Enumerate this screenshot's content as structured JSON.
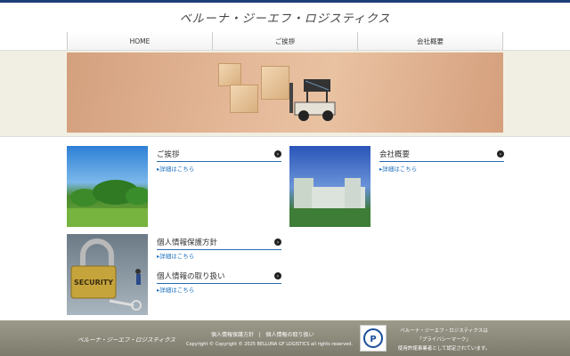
{
  "header": {
    "title": "ベルーナ・ジーエフ・ロジスティクス"
  },
  "nav": {
    "items": [
      {
        "label": "HOME"
      },
      {
        "label": "ご挨拶"
      },
      {
        "label": "会社概要"
      }
    ]
  },
  "sections": {
    "greeting": {
      "title": "ご挨拶",
      "link": "詳細はこちら"
    },
    "company": {
      "title": "会社概要",
      "link": "詳細はこちら"
    },
    "privacy_policy": {
      "title": "個人情報保護方針",
      "link": "詳細はこちら"
    },
    "privacy_handling": {
      "title": "個人情報の取り扱い",
      "link": "詳細はこちら"
    }
  },
  "thumb_text": {
    "security": "SECURITY"
  },
  "footer": {
    "company": "ベルーナ・ジーエフ・ロジスティクス",
    "link1": "個人情報保護方針",
    "separator": "|",
    "link2": "個人情報の取り扱い",
    "copyright": "Copyright © Copyright © 2025 BELLUNA GF LOGISTICS all rights reserved.",
    "pmark_line1": "ベルーナ・ジーエフ・ロジスティクスは",
    "pmark_line2": "「プライバシーマーク」",
    "pmark_line3": "使用許諾事業者として認定されています。"
  },
  "colors": {
    "accent": "#1f3f7a",
    "link": "#1a6fbf",
    "footer": "#8e8c7d"
  }
}
